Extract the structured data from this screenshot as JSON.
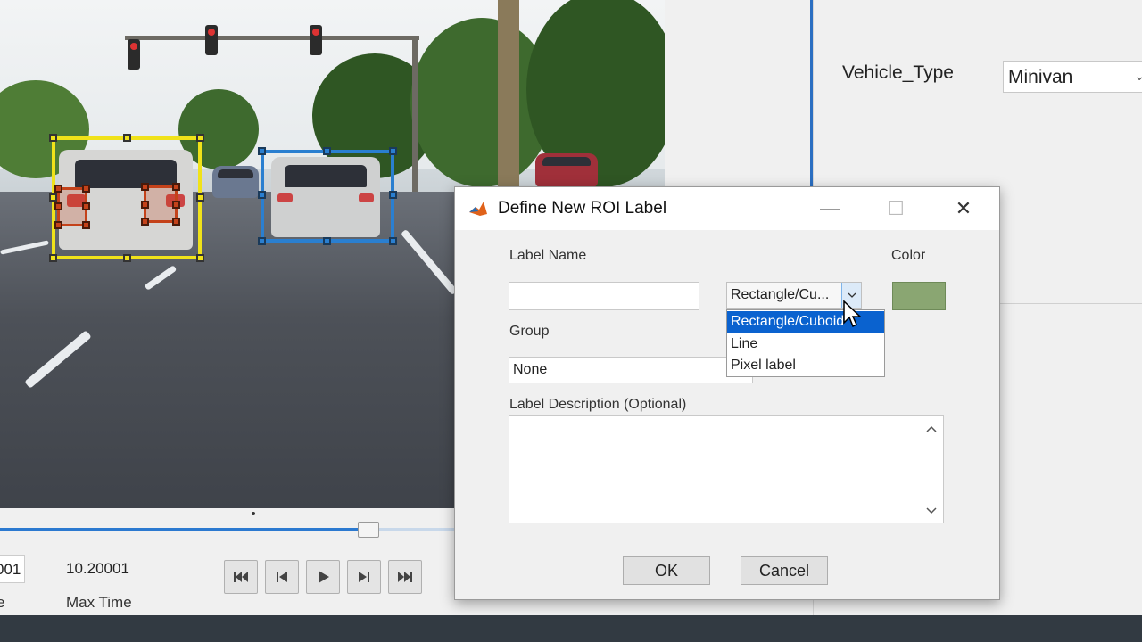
{
  "dialog": {
    "title": "Define New ROI Label",
    "label_name_caption": "Label Name",
    "label_name_value": "",
    "color_caption": "Color",
    "color_value": "#8aa672",
    "roi_type_selected": "Rectangle/Cu...",
    "roi_type_options": [
      "Rectangle/Cuboid",
      "Line",
      "Pixel label"
    ],
    "group_caption": "Group",
    "group_value": "None",
    "description_caption": "Label Description (Optional)",
    "description_value": "",
    "ok_label": "OK",
    "cancel_label": "Cancel",
    "minimize_glyph": "—",
    "maximize_glyph": "☐",
    "close_glyph": "✕"
  },
  "attributes": {
    "name": "Vehicle_Type",
    "value": "Minivan"
  },
  "playback": {
    "current_time_partial": "001",
    "max_time_value": "10.20001",
    "max_time_label": "Max Time",
    "current_time_label_partial": "e",
    "progress_fraction": 0.81
  },
  "colors": {
    "accent": "#0a62cf",
    "roi_yellow": "#f0e21a",
    "roi_blue": "#2a7fd0",
    "roi_orange": "#c4421a"
  }
}
